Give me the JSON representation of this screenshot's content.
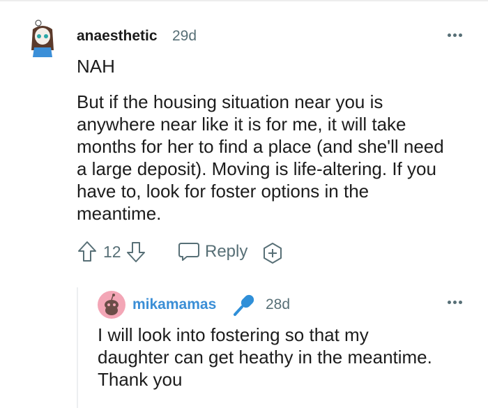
{
  "comment": {
    "author": "anaesthetic",
    "age": "29d",
    "paragraph1": "NAH",
    "body_lines": [
      "But if the housing situation near you is",
      "anywhere near like it is for me, it will take",
      "months for her to find a place (and she'll need",
      "a large deposit). Moving is life-altering. If you",
      "have to, look for foster options in the",
      "meantime."
    ],
    "votes": "12",
    "reply_label": "Reply"
  },
  "reply": {
    "author": "mikamamas",
    "age": "28d",
    "body_lines": [
      "I will look into fostering so that my",
      "daughter can get heathy in the meantime.",
      "Thank you"
    ]
  },
  "colors": {
    "author_reply": "#3a8ed6",
    "mic_icon": "#2f8fd8",
    "avatar_bg": "#f3a6b6",
    "muted": "#576f76"
  },
  "icons": [
    "avatar-icon",
    "more-options-icon",
    "upvote-icon",
    "downvote-icon",
    "reply-icon",
    "award-icon",
    "mic-icon",
    "snoo-avatar-icon"
  ]
}
